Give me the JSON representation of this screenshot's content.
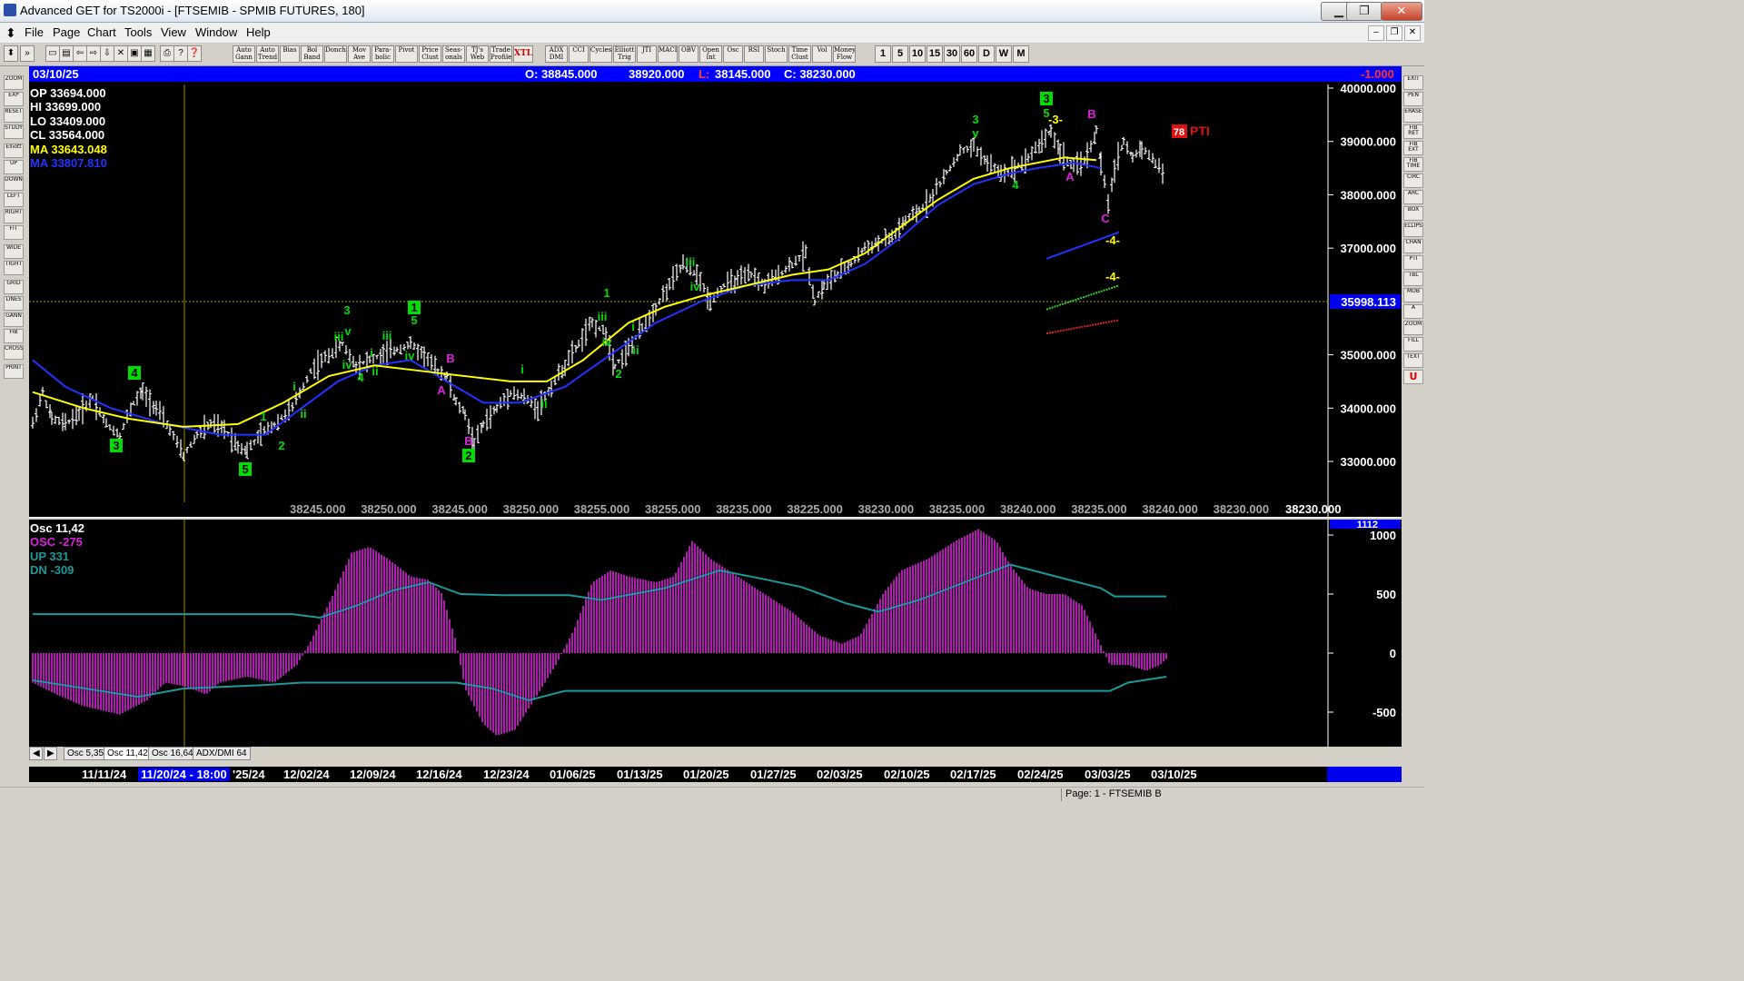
{
  "window": {
    "title": "Advanced GET for TS2000i - [FTSEMIB - SPMIB FUTURES, 180]",
    "minimize": "▁",
    "maximize": "❐",
    "close": "✕"
  },
  "menu": [
    "File",
    "Page",
    "Chart",
    "Tools",
    "View",
    "Window",
    "Help"
  ],
  "toolbar": {
    "study_buttons": [
      "Auto Gann",
      "Auto Trend",
      "Bias",
      "Bol Band",
      "Donch",
      "Mov Ave",
      "Para-bolic",
      "Pivot",
      "Price Clust",
      "Seas-onals",
      "TJ's Web",
      "Trade Profile",
      "XTL",
      "ADX DMI",
      "CCI",
      "Cycles",
      "Elliott Trig",
      "JTI",
      "MACD",
      "OBV",
      "Open Int",
      "Osc",
      "RSI",
      "Stoch",
      "Time Clust",
      "Vol",
      "Money Flow"
    ],
    "interval_buttons": [
      "1",
      "5",
      "10",
      "15",
      "30",
      "60",
      "D",
      "W",
      "M"
    ]
  },
  "left_tools": [
    "ZOOM",
    "EXP",
    "RESET",
    "STUDY",
    "Elliott",
    "UP",
    "DOWN",
    "LEFT",
    "RIGHT",
    "FIT",
    "WIDE",
    "TIGHT",
    "GRID",
    "LINES",
    "GANN",
    "FIB",
    "CROSS",
    "PRINT"
  ],
  "right_tools": [
    "EXIT",
    "PEN",
    "ERASE",
    "FIB RET",
    "FIB EXT",
    "FIB TIME",
    "CIRC",
    "ARC",
    "BOX",
    "ELLIPS",
    "CHAN",
    "PTI",
    "TBL",
    "MOB",
    "A",
    "ZOOM",
    "FILL",
    "TEXT",
    "U"
  ],
  "chart": {
    "date": "03/10/25",
    "open": "O: 38845.000",
    "high": "38920.000",
    "low_label": "L:",
    "low": "38145.000",
    "close": "C: 38230.000",
    "change": "-1.000",
    "crosshair_price": "35998.113",
    "pti_value": "78",
    "pti_label": "PTI",
    "overlay": {
      "op": "OP  33694.000",
      "hi": "HI   33699.000",
      "lo": "LO  33409.000",
      "cl": "CL  33564.000",
      "ma1": "MA  33643.048",
      "ma2": "MA  33807.810"
    },
    "colors": {
      "bar": "#ffffff",
      "ma_fast": "#ffff00",
      "ma_slow": "#2233ff",
      "wave": "#00dd00",
      "abc": "#dd22dd",
      "osc": "#dd22dd",
      "band": "#1a9a9a"
    },
    "price_axis": [
      "40000.000",
      "39000.000",
      "38000.000",
      "37000.000",
      "35000.000",
      "34000.000",
      "33000.000"
    ],
    "bottom_values": [
      "38245.000",
      "38250.000",
      "38245.000",
      "38250.000",
      "38255.000",
      "38255.000",
      "38235.000",
      "38225.000",
      "38230.000",
      "38235.000",
      "38240.000",
      "38235.000",
      "38240.000",
      "38230.000",
      "38230.000"
    ],
    "wave_labels": [
      {
        "t": "4",
        "box": true
      },
      {
        "t": "3",
        "box": true
      },
      {
        "t": "5",
        "box": true
      },
      {
        "t": "1",
        "box": true
      },
      {
        "t": "2",
        "box": true
      },
      {
        "t": "3",
        "box": true
      },
      {
        "t": "1"
      },
      {
        "t": "2"
      },
      {
        "t": "i"
      },
      {
        "t": "ii"
      },
      {
        "t": "3"
      },
      {
        "t": "v"
      },
      {
        "t": "iii"
      },
      {
        "t": "iv"
      },
      {
        "t": "4"
      },
      {
        "t": "i"
      },
      {
        "t": "ii"
      },
      {
        "t": "iii"
      },
      {
        "t": "5"
      },
      {
        "t": "iv"
      },
      {
        "t": "B",
        "abc": true
      },
      {
        "t": "A",
        "abc": true
      },
      {
        "t": "B",
        "abc": true
      },
      {
        "t": "i"
      },
      {
        "t": "ii"
      },
      {
        "t": "1"
      },
      {
        "t": "iii"
      },
      {
        "t": "iv"
      },
      {
        "t": "i"
      },
      {
        "t": "ii"
      },
      {
        "t": "2"
      },
      {
        "t": "iii"
      },
      {
        "t": "iv"
      },
      {
        "t": "3"
      },
      {
        "t": "v"
      },
      {
        "t": "4"
      },
      {
        "t": "5"
      },
      {
        "t": "-3-"
      },
      {
        "t": "B",
        "abc": true
      },
      {
        "t": "A",
        "abc": true
      },
      {
        "t": "C",
        "abc": true
      },
      {
        "t": "-4-"
      },
      {
        "t": "-4-"
      }
    ],
    "last_close": "38230.000"
  },
  "oscillator": {
    "title": "Osc 11,42",
    "osc": "OSC -275",
    "up": "UP   331",
    "dn": "DN   -309",
    "current": "1112",
    "axis": [
      "1000",
      "500",
      "0",
      "-500"
    ],
    "tabs": [
      "Osc 5,35",
      "Osc 11,42",
      "Osc 16,64",
      "ADX/DMI 64"
    ]
  },
  "dates": [
    "11/11/24",
    "11/20/24 - 18:00",
    "'25/24",
    "12/02/24",
    "12/09/24",
    "12/16/24",
    "12/23/24",
    "01/06/25",
    "01/13/25",
    "01/20/25",
    "01/27/25",
    "02/03/25",
    "02/10/25",
    "02/17/25",
    "02/24/25",
    "03/03/25",
    "03/10/25"
  ],
  "status": "Page: 1 - FTSEMIB B"
}
